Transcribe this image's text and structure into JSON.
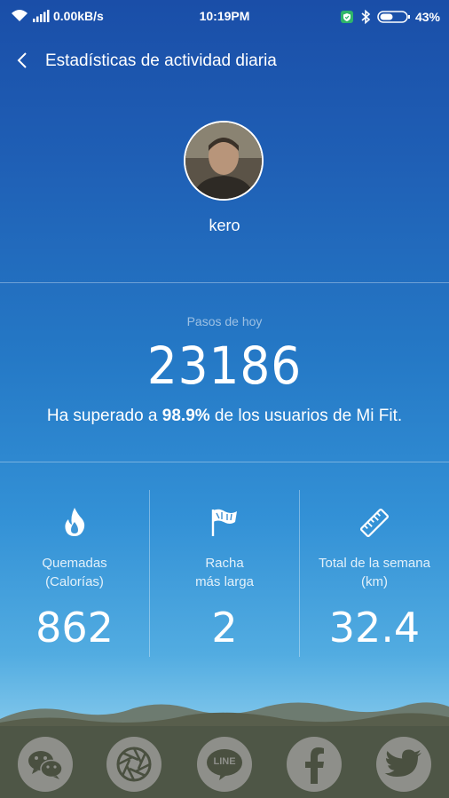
{
  "status_bar": {
    "network_speed": "0.00kB/s",
    "time": "10:19PM",
    "battery": "43%"
  },
  "header": {
    "title": "Estadísticas de actividad diaria"
  },
  "profile": {
    "username": "kero"
  },
  "steps": {
    "label": "Pasos de hoy",
    "value": "23186",
    "rank_prefix": "Ha superado a ",
    "rank_value": "98.9%",
    "rank_suffix": " de los usuarios de Mi Fit."
  },
  "stats": [
    {
      "icon": "flame-icon",
      "label_line1": "Quemadas",
      "label_line2": "(Calorías)",
      "value": "862"
    },
    {
      "icon": "flag-icon",
      "label_line1": "Racha",
      "label_line2": "más larga",
      "value": "2"
    },
    {
      "icon": "ruler-icon",
      "label_line1": "Total de la semana",
      "label_line2": "(km)",
      "value": "32.4"
    }
  ],
  "share": {
    "items": [
      "wechat",
      "moments",
      "line",
      "facebook",
      "twitter"
    ],
    "line_label": "LINE"
  },
  "colors": {
    "gradient_top": "#1a4ea8",
    "gradient_bottom": "#8ecdee",
    "share_bar": "#4e5646",
    "share_button": "#8e8f8a",
    "status_green": "#2fb56a"
  }
}
